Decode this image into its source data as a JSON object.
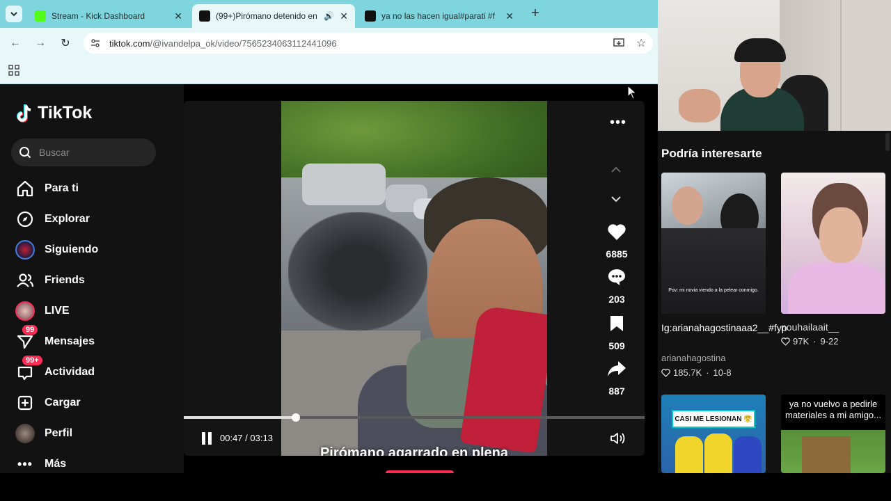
{
  "browser": {
    "tabs": [
      {
        "title": "Stream - Kick Dashboard",
        "favicon_color": "#53fc18",
        "active": false
      },
      {
        "title": "(99+)Pirómano detenido en",
        "favicon_color": "#111111",
        "active": true
      },
      {
        "title": "ya no las hacen igual#parati #f",
        "favicon_color": "#111111",
        "active": false
      }
    ],
    "url_domain": "tiktok.com",
    "url_path": "/@ivandelpa_ok/video/7565234063112441096"
  },
  "sidebar": {
    "logo_text": "TikTok",
    "search_placeholder": "Buscar",
    "items": [
      {
        "label": "Para ti",
        "icon": "home-icon"
      },
      {
        "label": "Explorar",
        "icon": "compass-icon"
      },
      {
        "label": "Siguiendo",
        "icon": "following-avatar-icon"
      },
      {
        "label": "Friends",
        "icon": "friends-icon"
      },
      {
        "label": "LIVE",
        "icon": "live-avatar-icon"
      },
      {
        "label": "Mensajes",
        "icon": "messages-icon",
        "badge": "99"
      },
      {
        "label": "Actividad",
        "icon": "activity-icon",
        "badge": "99+"
      },
      {
        "label": "Cargar",
        "icon": "upload-icon"
      },
      {
        "label": "Perfil",
        "icon": "profile-avatar-icon"
      },
      {
        "label": "Más",
        "icon": "more-icon"
      }
    ]
  },
  "player": {
    "caption": "Pirómano agarrado en plena",
    "likes": "6885",
    "comments": "203",
    "saves": "509",
    "shares": "887",
    "current_time": "00:47",
    "duration": "03:13",
    "progress": 0.243
  },
  "recommendations": {
    "title": "Podría interesarte",
    "items": [
      {
        "title": "Ig:arianahagostinaaa2__#fyp",
        "author": "arianahagostina",
        "likes": "185.7K",
        "date": "10-8",
        "overlay": "Pov: mi novia viendo a la pelear conmigo."
      },
      {
        "title": "",
        "author": "nouhailaait__",
        "likes": "97K",
        "date": "9-22",
        "overlay": ""
      },
      {
        "title": "",
        "author": "",
        "likes": "",
        "date": "",
        "overlay": "CASI ME LESIONAN 😤"
      },
      {
        "title": "",
        "author": "",
        "likes": "",
        "date": "",
        "overlay": "ya no vuelvo a pedirle materiales a mi amigo..."
      }
    ]
  },
  "colors": {
    "tiktok_red": "#fe2c55",
    "browser_accent": "#7fd5de"
  }
}
